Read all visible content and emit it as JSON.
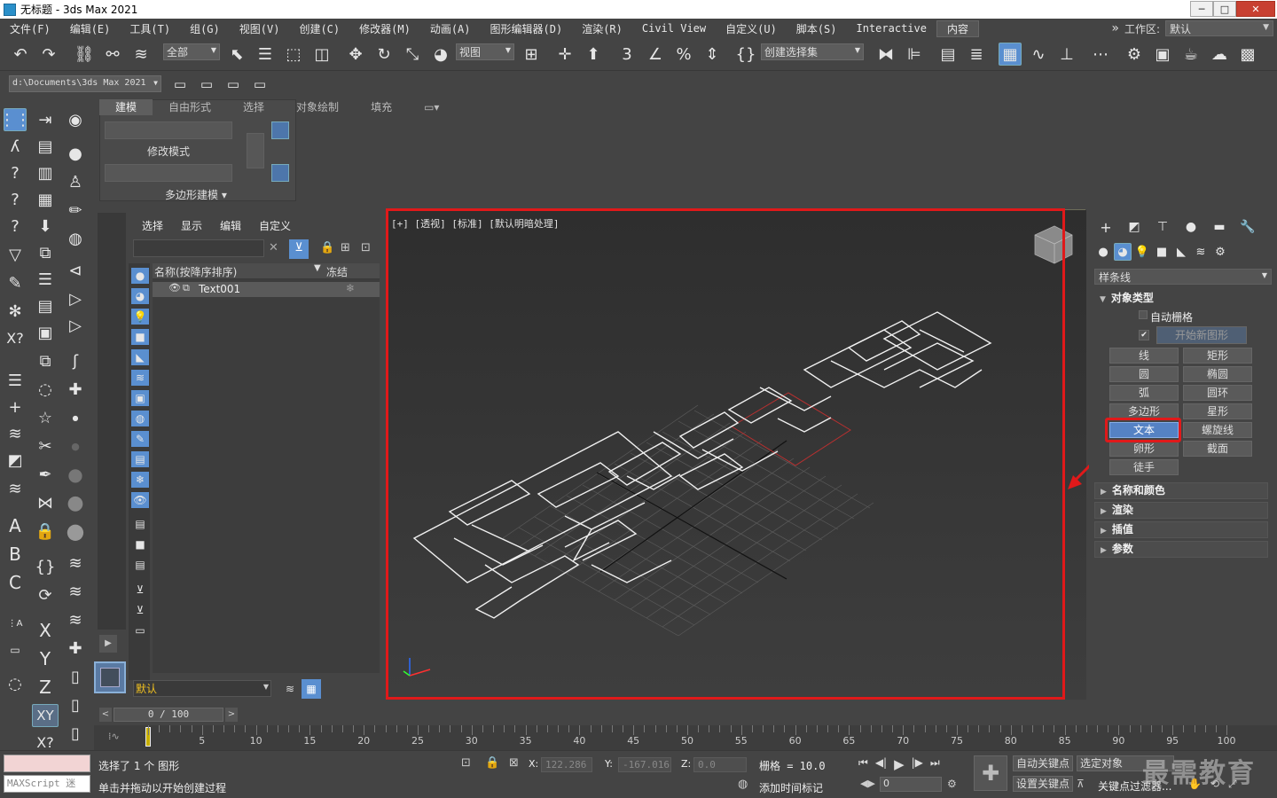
{
  "window": {
    "title": "无标题 - 3ds Max 2021",
    "minimize": "─",
    "maximize": "□",
    "close": "✕"
  },
  "menu": [
    "文件(F)",
    "编辑(E)",
    "工具(T)",
    "组(G)",
    "视图(V)",
    "创建(C)",
    "修改器(M)",
    "动画(A)",
    "图形编辑器(D)",
    "渲染(R)",
    "Civil View",
    "自定义(U)",
    "脚本(S)",
    "Interactive",
    "内容"
  ],
  "workspace": {
    "chevron": "»",
    "label": "工作区:",
    "value": "默认"
  },
  "toolbar": {
    "filter": "全部",
    "refcoord": "视图",
    "selset": "创建选择集"
  },
  "toolbar2": {
    "path": "d:\\Documents\\3ds Max 2021"
  },
  "ribbon": {
    "tabs": [
      "建模",
      "自由形式",
      "选择",
      "对象绘制",
      "填充"
    ],
    "mode": "修改模式",
    "group": "多边形建模 ▾"
  },
  "scene": {
    "tabs": [
      "选择",
      "显示",
      "编辑",
      "自定义"
    ],
    "col_name": "名称(按降序排序)",
    "col_freeze": "冻结",
    "object": "Text001",
    "layer": "默认"
  },
  "viewport": {
    "label": "[+] [透视] [标准] [默认明暗处理]"
  },
  "command_panel": {
    "category": "样条线",
    "rollout_object_type": "对象类型",
    "autogrid": "自动栅格",
    "start_new_shape": "开始新图形",
    "buttons": [
      "线",
      "矩形",
      "圆",
      "椭圆",
      "弧",
      "圆环",
      "多边形",
      "星形",
      "文本",
      "螺旋线",
      "卵形",
      "截面",
      "徒手"
    ],
    "active_button": "文本",
    "rollouts": [
      "名称和颜色",
      "渲染",
      "插值",
      "参数"
    ]
  },
  "timeline": {
    "frame": "0 / 100",
    "ticks": [
      0,
      5,
      10,
      15,
      20,
      25,
      30,
      35,
      40,
      45,
      50,
      55,
      60,
      65,
      70,
      75,
      80,
      85,
      90,
      95,
      100
    ]
  },
  "status": {
    "maxscript": "MAXScript 迷",
    "selected": "选择了 1 个 图形",
    "prompt": "单击并拖动以开始创建过程",
    "x_label": "X:",
    "x": "122.286",
    "y_label": "Y:",
    "y": "-167.016",
    "z_label": "Z:",
    "z": "0.0",
    "grid": "栅格 = 10.0",
    "add_tag": "添加时间标记",
    "autokey": "自动关键点",
    "setkey": "设置关键点",
    "selobj": "选定对象",
    "keyfilter": "关键点过滤器...",
    "frame_field": "0"
  },
  "watermark": "最需教育",
  "colors": {
    "accent": "#5582c4",
    "highlight": "#e0191a",
    "background": "#444444"
  }
}
